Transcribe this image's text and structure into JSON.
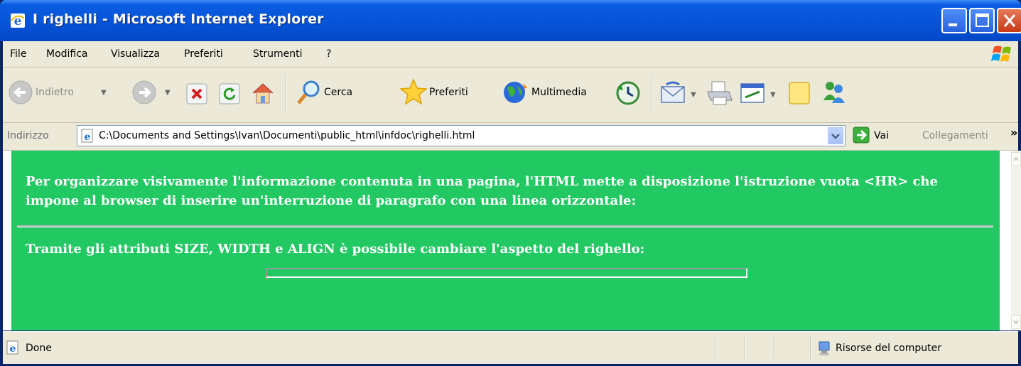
{
  "window": {
    "title": "I righelli - Microsoft Internet Explorer"
  },
  "menu": {
    "items": [
      "File",
      "Modifica",
      "Visualizza",
      "Preferiti",
      "Strumenti",
      "?"
    ]
  },
  "toolbar": {
    "back_label": "Indietro",
    "search_label": "Cerca",
    "favorites_label": "Preferiti",
    "media_label": "Multimedia"
  },
  "address": {
    "label": "Indirizzo",
    "url": "C:\\Documents and Settings\\Ivan\\Documenti\\public_html\\infdoc\\righelli.html",
    "go_label": "Vai",
    "links_label": "Collegamenti",
    "links_chevron": "»"
  },
  "content": {
    "background": "#22c862",
    "paragraph1": "Per organizzare visivamente l'informazione contenuta in una pagina, l'HTML mette a disposizione l'istruzione vuota <HR> che impone al browser di inserire un'interruzione di paragrafo con una linea orizzontale:",
    "paragraph2": "Tramite gli attributi SIZE, WIDTH e ALIGN è possibile cambiare l'aspetto del righello:"
  },
  "status": {
    "text": "Done",
    "zone": "Risorse del computer"
  }
}
